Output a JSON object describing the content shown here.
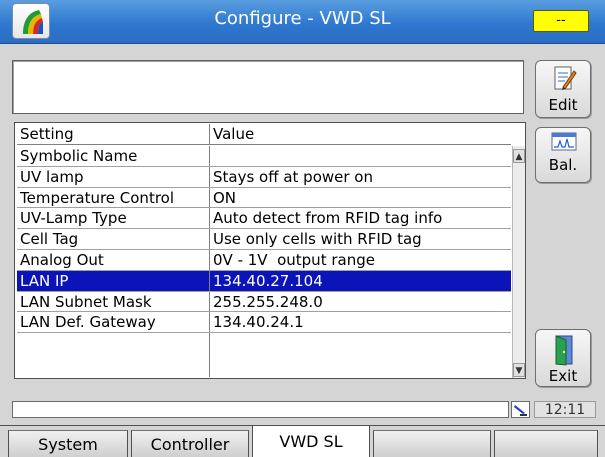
{
  "window": {
    "title": "Configure - VWD SL",
    "status_indicator": "--",
    "status_color": "#ffff00"
  },
  "info_box": {
    "text": ""
  },
  "side_buttons": {
    "edit_label": "Edit",
    "bal_label": "Bal.",
    "exit_label": "Exit"
  },
  "table": {
    "headers": {
      "setting": "Setting",
      "value": "Value"
    },
    "rows": [
      {
        "setting": "Symbolic Name",
        "value": ""
      },
      {
        "setting": "UV lamp",
        "value": "Stays off at power on"
      },
      {
        "setting": "Temperature Control",
        "value": "ON"
      },
      {
        "setting": "UV-Lamp Type",
        "value": "Auto detect from RFID tag info"
      },
      {
        "setting": "Cell Tag",
        "value": "Use only cells with RFID tag"
      },
      {
        "setting": "Analog Out",
        "value": "0V - 1V  output range"
      },
      {
        "setting": "LAN IP",
        "value": "134.40.27.104",
        "selected": true
      },
      {
        "setting": "LAN Subnet Mask",
        "value": "255.255.248.0"
      },
      {
        "setting": "LAN Def. Gateway",
        "value": "134.40.24.1"
      }
    ],
    "selection_color": "#0a14b8"
  },
  "statusbar": {
    "message": "",
    "clock": "12:11"
  },
  "tabs": [
    {
      "label": "System"
    },
    {
      "label": "Controller"
    },
    {
      "label": "VWD SL",
      "active": true
    },
    {
      "label": ""
    },
    {
      "label": ""
    }
  ]
}
